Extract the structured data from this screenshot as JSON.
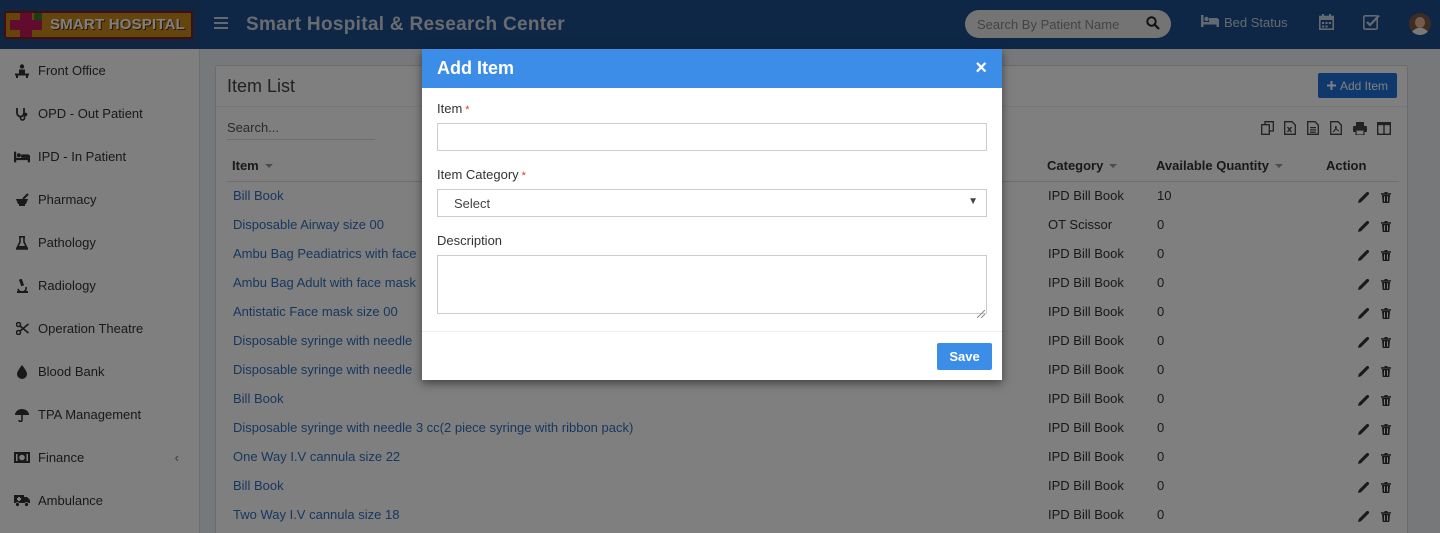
{
  "app": {
    "logo_text": "SMART HOSPITAL",
    "title": "Smart Hospital & Research Center"
  },
  "header": {
    "search_placeholder": "Search By Patient Name",
    "bed_status_label": "Bed Status",
    "icons": [
      "menu-icon",
      "search-icon",
      "bed-icon",
      "calendar-icon",
      "checklist-icon",
      "user-avatar"
    ]
  },
  "sidebar": {
    "items": [
      {
        "label": "Front Office",
        "icon": "front-office-icon"
      },
      {
        "label": "OPD - Out Patient",
        "icon": "stethoscope-icon"
      },
      {
        "label": "IPD - In Patient",
        "icon": "bed-icon"
      },
      {
        "label": "Pharmacy",
        "icon": "mortar-pestle-icon"
      },
      {
        "label": "Pathology",
        "icon": "flask-icon"
      },
      {
        "label": "Radiology",
        "icon": "microscope-icon"
      },
      {
        "label": "Operation Theatre",
        "icon": "scissors-icon"
      },
      {
        "label": "Blood Bank",
        "icon": "blood-drop-icon"
      },
      {
        "label": "TPA Management",
        "icon": "umbrella-icon"
      },
      {
        "label": "Finance",
        "icon": "money-icon",
        "chevron": "‹"
      },
      {
        "label": "Ambulance",
        "icon": "ambulance-icon"
      }
    ]
  },
  "item_list": {
    "title": "Item List",
    "add_button": "Add Item",
    "search_placeholder": "Search...",
    "columns": {
      "item": "Item",
      "category": "Category",
      "available_quantity": "Available Quantity",
      "action": "Action"
    },
    "rows": [
      {
        "item": "Bill Book",
        "category": "IPD Bill Book",
        "qty": "10"
      },
      {
        "item": "Disposable Airway size 00",
        "category": "OT Scissor",
        "qty": "0"
      },
      {
        "item": "Ambu Bag Peadiatrics with face",
        "category": "IPD Bill Book",
        "qty": "0"
      },
      {
        "item": "Ambu Bag Adult with face mask",
        "category": "IPD Bill Book",
        "qty": "0"
      },
      {
        "item": "Antistatic Face mask size 00",
        "category": "IPD Bill Book",
        "qty": "0"
      },
      {
        "item": "Disposable syringe with needle",
        "category": "IPD Bill Book",
        "qty": "0"
      },
      {
        "item": "Disposable syringe with needle",
        "category": "IPD Bill Book",
        "qty": "0"
      },
      {
        "item": "Bill Book",
        "category": "IPD Bill Book",
        "qty": "0"
      },
      {
        "item": "Disposable syringe with needle 3 cc(2 piece syringe with ribbon pack)",
        "category": "IPD Bill Book",
        "qty": "0"
      },
      {
        "item": "One Way I.V cannula size 22",
        "category": "IPD Bill Book",
        "qty": "0"
      },
      {
        "item": "Bill Book",
        "category": "IPD Bill Book",
        "qty": "0"
      },
      {
        "item": "Two Way I.V cannula size 18",
        "category": "IPD Bill Book",
        "qty": "0"
      }
    ]
  },
  "modal": {
    "title": "Add Item",
    "close_symbol": "×",
    "fields": {
      "item_label": "Item",
      "item_value": "",
      "category_label": "Item Category",
      "category_selected": "Select",
      "description_label": "Description",
      "description_value": "",
      "required_mark": "*"
    },
    "save_button": "Save"
  },
  "colors": {
    "header_bg": "#1f4e8c",
    "modal_header": "#3b8de8",
    "link": "#2f6fbf",
    "primary_button": "#1e73d8"
  }
}
